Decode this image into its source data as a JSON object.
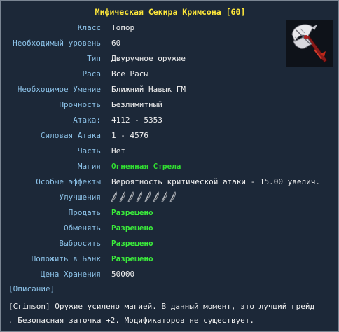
{
  "item": {
    "title": "Мифическая Секира Кримсона [60]",
    "image_icon": "crimson-battle-axe-icon"
  },
  "rows": [
    {
      "label": "Класс",
      "value": "Топор"
    },
    {
      "label": "Необходимый уровень",
      "value": "60"
    },
    {
      "label": "Тип",
      "value": "Двуручное оружие"
    },
    {
      "label": "Раса",
      "value": "Все Расы"
    },
    {
      "label": "Необходимое Умение",
      "value": "Ближний Навык ГМ"
    },
    {
      "label": "Прочность",
      "value": "Безлимитный"
    },
    {
      "label": "Атака:",
      "value": "4112 - 5353"
    },
    {
      "label": "Силовая Атака",
      "value": "1 - 4576"
    },
    {
      "label": "Часть",
      "value": "Нет"
    },
    {
      "label": "Магия",
      "value": "Огненная Стрела"
    },
    {
      "label": "Особые эффекты",
      "value": "Вероятность критической атаки - 15.00 увелич."
    },
    {
      "label": "Улучшения",
      "slots": 8,
      "slot_icon": "empty-upgrade-slot-icon"
    },
    {
      "label": "Продать",
      "value": "Разрешено"
    },
    {
      "label": "Обменять",
      "value": "Разрешено"
    },
    {
      "label": "Выбросить",
      "value": "Разрешено"
    },
    {
      "label": "Положить в Банк",
      "value": "Разрешено"
    },
    {
      "label": "Цена Хранения",
      "value": "50000"
    }
  ],
  "description": {
    "header": "[Описание]",
    "line1": "[Crimson] Оружие усилено магией. В данный момент, это лучший грейд",
    "line2": ". Безопасная заточка +2. Модификаторов не существует."
  },
  "colors": {
    "background": "#1c2838",
    "title": "#ffe83a",
    "label": "#8cc2e8",
    "value": "#f0f0f0",
    "allowed": "#3bee3b"
  }
}
